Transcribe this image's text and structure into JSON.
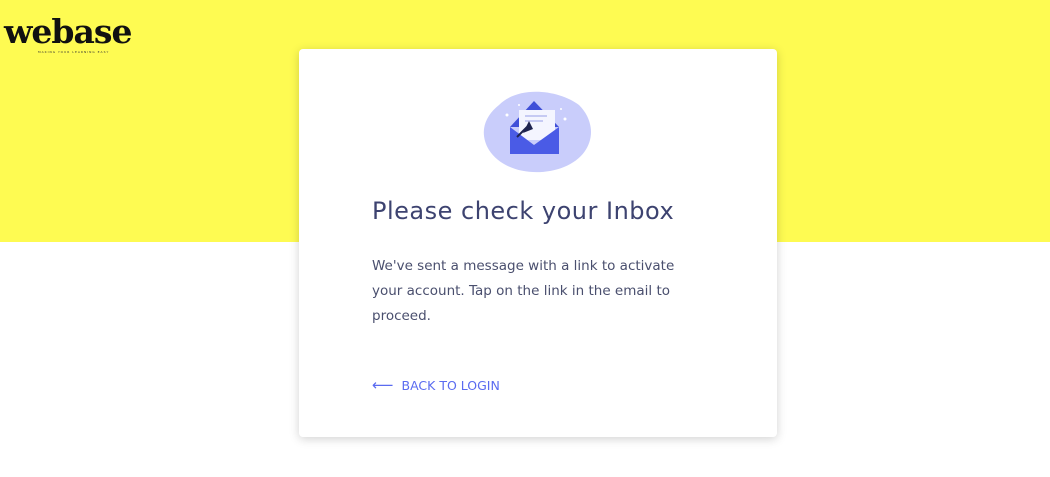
{
  "logo": {
    "name": "webase",
    "tagline": "MAKING YOUR LEARNING EASY"
  },
  "card": {
    "icon": "envelope-icon",
    "title": "Please check your Inbox",
    "message": "We've sent a message with a link to activate your account. Tap on the link in the email to proceed.",
    "back_link": "BACK TO LOGIN"
  },
  "colors": {
    "band": "#fefb52",
    "accent": "#5a6bf0",
    "title": "#3d4370"
  }
}
